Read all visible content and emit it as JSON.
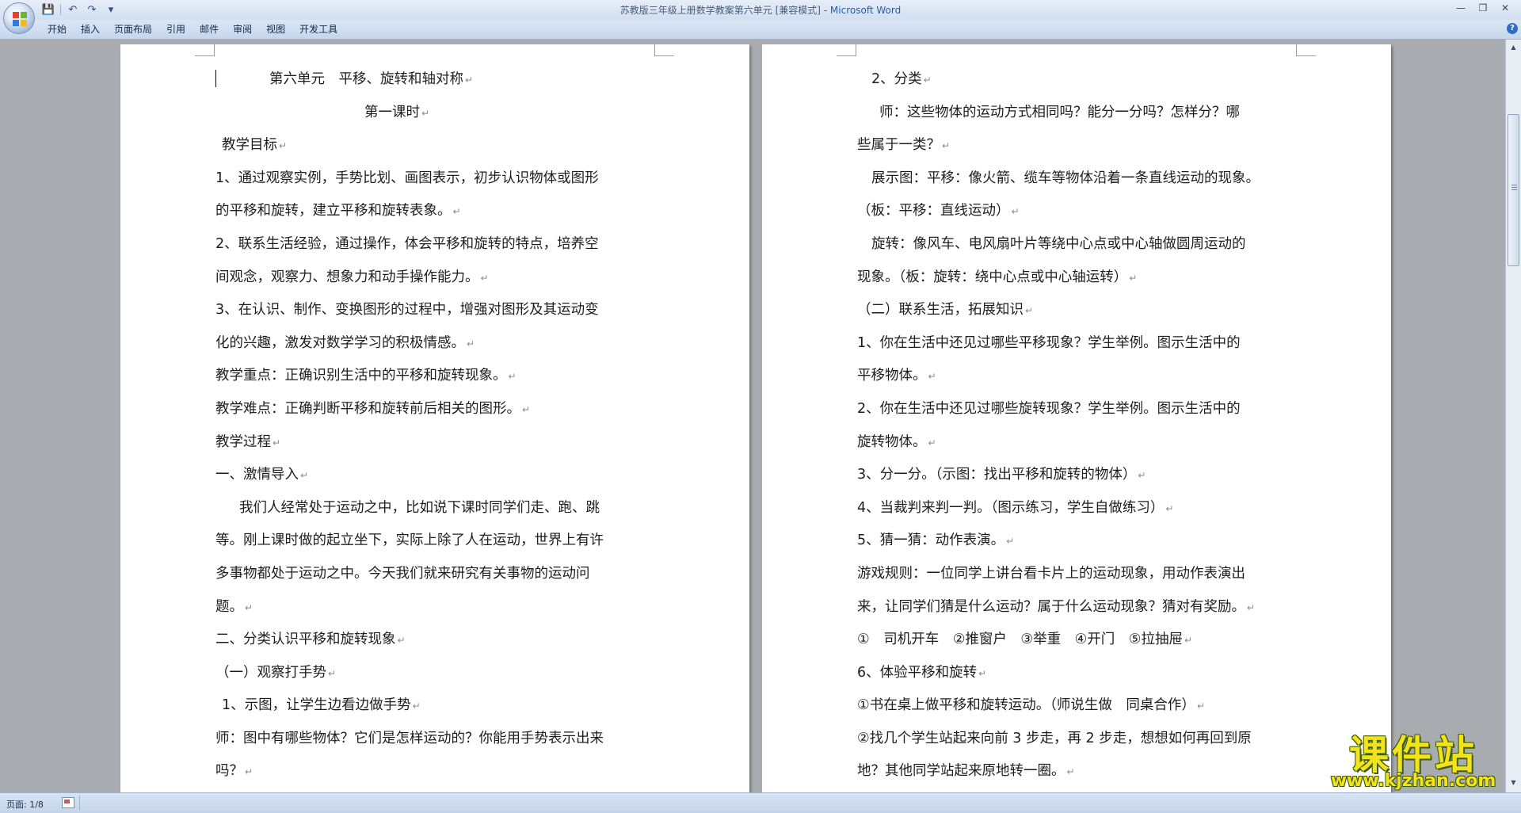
{
  "window": {
    "title_prefix": "苏教版三年级上册数学教案第六单元 [兼容模式] - ",
    "title_app": "Microsoft Word",
    "minimize": "—",
    "restore": "❐",
    "close": "✕"
  },
  "qat": {
    "save_icon": "💾",
    "undo_icon": "↶",
    "redo_icon": "↷",
    "more_icon": "▾"
  },
  "ribbon": {
    "tabs": [
      "开始",
      "插入",
      "页面布局",
      "引用",
      "邮件",
      "审阅",
      "视图",
      "开发工具"
    ],
    "help": "?"
  },
  "document": {
    "left_page": {
      "lines": [
        "第六单元　平移、旋转和轴对称",
        "第一课时",
        "教学目标",
        "1、通过观察实例，手势比划、画图表示，初步认识物体或图形",
        "的平移和旋转，建立平移和旋转表象。",
        "2、联系生活经验，通过操作，体会平移和旋转的特点，培养空",
        "间观念，观察力、想象力和动手操作能力。",
        "3、在认识、制作、变换图形的过程中，增强对图形及其运动变",
        "化的兴趣，激发对数学学习的积极情感。",
        "教学重点：正确识别生活中的平移和旋转现象。",
        "教学难点：正确判断平移和旋转前后相关的图形。",
        "教学过程",
        "一、激情导入",
        "我们人经常处于运动之中，比如说下课时同学们走、跑、跳",
        "等。刚上课时做的起立坐下，实际上除了人在运动，世界上有许",
        "多事物都处于运动之中。今天我们就来研究有关事物的运动问",
        "题。",
        "二、分类认识平移和旋转现象",
        "（一）观察打手势",
        "1、示图，让学生边看边做手势",
        "师：图中有哪些物体？它们是怎样运动的？你能用手势表示出来",
        "吗？"
      ]
    },
    "right_page": {
      "lines": [
        "2、分类",
        "师：这些物体的运动方式相同吗？能分一分吗？怎样分？哪",
        "些属于一类？",
        "展示图：平移：像火箭、缆车等物体沿着一条直线运动的现象。",
        "（板：平移：直线运动）",
        "旋转：像风车、电风扇叶片等绕中心点或中心轴做圆周运动的",
        "现象。（板：旋转：绕中心点或中心轴运转）",
        "（二）联系生活，拓展知识",
        "1、你在生活中还见过哪些平移现象？学生举例。图示生活中的",
        "平移物体。",
        "2、你在生活中还见过哪些旋转现象？学生举例。图示生活中的",
        "旋转物体。",
        "3、分一分。（示图：找出平移和旋转的物体）",
        "4、当裁判来判一判。（图示练习，学生自做练习）",
        "5、猜一猜：动作表演。",
        "游戏规则：一位同学上讲台看卡片上的运动现象，用动作表演出",
        "来，让同学们猜是什么运动？属于什么运动现象？猜对有奖励。",
        "①　司机开车　②推窗户　③举重　④开门　⑤拉抽屉",
        "6、体验平移和旋转",
        "①书在桌上做平移和旋转运动。（师说生做　同桌合作）",
        "②找几个学生站起来向前 3 步走，再 2 步走，想想如何再回到原",
        "地？其他同学站起来原地转一圈。"
      ]
    }
  },
  "statusbar": {
    "page_info": "页面: 1/8"
  },
  "watermark": {
    "title": "课件站",
    "url": "www.kjzhan.com"
  },
  "scrollbar": {
    "up_icon": "▲",
    "down_icon": "▼"
  }
}
